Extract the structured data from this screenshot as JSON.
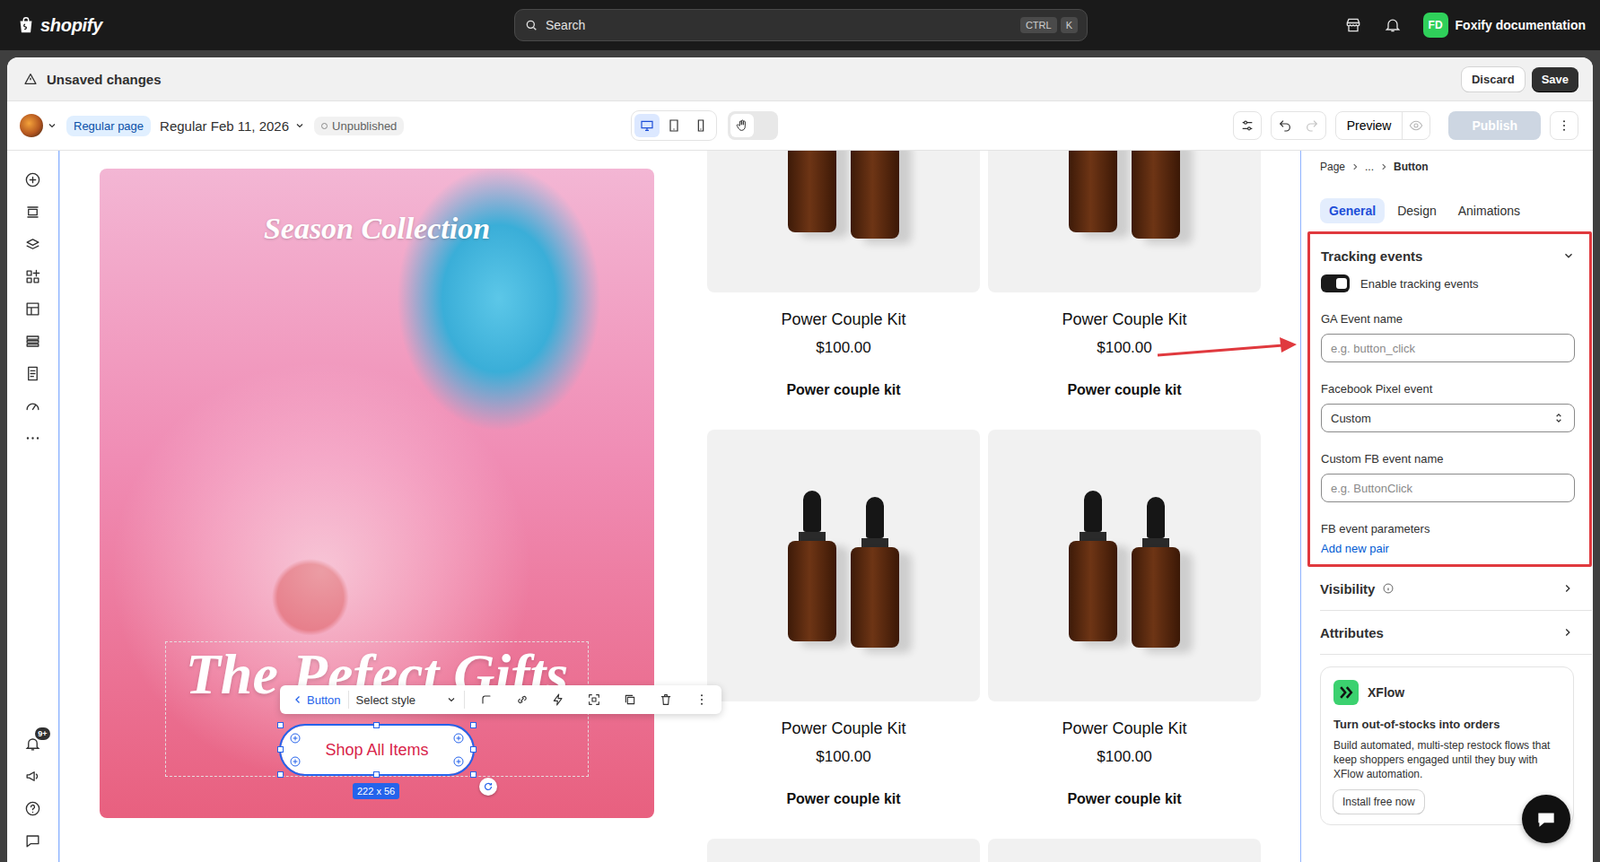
{
  "topbar": {
    "logo": "shopify",
    "search_placeholder": "Search",
    "shortcut": [
      "CTRL",
      "K"
    ],
    "store_initials": "FD",
    "store_name": "Foxify documentation"
  },
  "unsaved_bar": {
    "title": "Unsaved changes",
    "buttons": [
      {
        "label": "Discard",
        "primary": false
      },
      {
        "label": "Save",
        "primary": true
      }
    ]
  },
  "editor_toolbar": {
    "page_type": "Regular page",
    "page_name": "Regular Feb 11, 2026",
    "status": "Unpublished",
    "devices": [
      {
        "kind": "desktop",
        "selected": true
      },
      {
        "kind": "tablet",
        "selected": false
      },
      {
        "kind": "mobile",
        "selected": false
      }
    ],
    "hand_tool": {
      "selected": true
    },
    "undo_disabled": false,
    "redo_disabled": true,
    "preview": "Preview",
    "publish": {
      "label": "Publish",
      "disabled": true
    }
  },
  "left_rail": {
    "notification_badge": "9+"
  },
  "canvas": {
    "hero": {
      "heading": "Season Collection",
      "title": "The Pefect Gifts",
      "button": "Shop All Items",
      "size": "222 x 56",
      "selected": true
    },
    "element_toolbar": {
      "back": "Button",
      "style": "Select style"
    },
    "products": [
      {
        "kind": "full",
        "title": "Power Couple Kit",
        "price": "$100.00",
        "name": "Power couple kit"
      },
      {
        "kind": "full",
        "title": "Power Couple Kit",
        "price": "$100.00",
        "name": "Power couple kit"
      },
      {
        "kind": "full",
        "title": "Power Couple Kit",
        "price": "$100.00",
        "name": "Power couple kit"
      },
      {
        "kind": "full",
        "title": "Power Couple Kit",
        "price": "$100.00",
        "name": "Power couple kit"
      },
      {
        "kind": "image"
      },
      {
        "kind": "image"
      }
    ]
  },
  "panel": {
    "breadcrumb": [
      "Page",
      "...",
      "Button"
    ],
    "tabs": [
      {
        "label": "General",
        "selected": true
      },
      {
        "label": "Design",
        "selected": false
      },
      {
        "label": "Animations",
        "selected": false
      }
    ],
    "tracking": {
      "title": "Tracking events",
      "expanded": true,
      "toggle": {
        "label": "Enable tracking events",
        "on": true
      },
      "fields": [
        {
          "kind": "input",
          "label": "GA Event name",
          "placeholder": "e.g. button_click"
        },
        {
          "kind": "select",
          "label": "Facebook Pixel event",
          "value": "Custom"
        },
        {
          "kind": "input",
          "label": "Custom FB event name",
          "placeholder": "e.g. ButtonClick"
        }
      ],
      "params_label": "FB event parameters",
      "add_link": "Add new pair"
    },
    "sections": [
      {
        "title": "Visibility",
        "info": true
      },
      {
        "title": "Attributes",
        "info": false
      }
    ],
    "promo": {
      "name": "XFlow",
      "headline": "Turn out-of-stocks into orders",
      "body": "Build automated, multi-step restock flows that keep shoppers engaged until they buy with XFlow automation.",
      "button": "Install free now"
    }
  }
}
